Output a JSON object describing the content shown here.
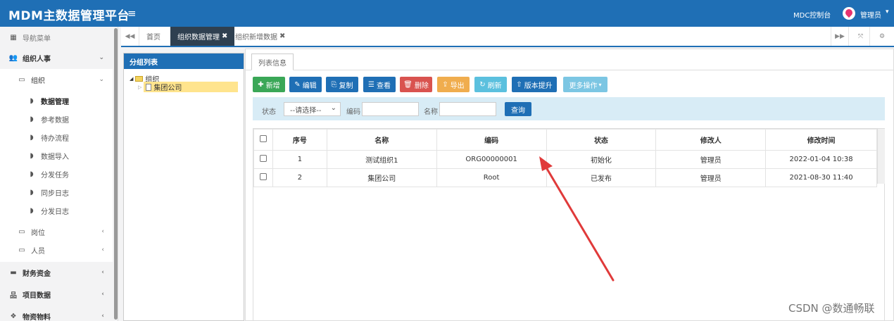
{
  "header": {
    "brand": "MDM主数据管理平台",
    "mdc_link": "MDC控制台",
    "user_name": "管理员"
  },
  "sidebar": {
    "nav_title": "导航菜单",
    "group_hr": "组织人事",
    "org": "组织",
    "org_items": [
      "数据管理",
      "参考数据",
      "待办流程",
      "数据导入",
      "分发任务",
      "同步日志",
      "分发日志"
    ],
    "position": "岗位",
    "person": "人员",
    "finance": "财务资金",
    "project": "项目数据",
    "material": "物资物料"
  },
  "tabs": {
    "home": "首页",
    "active": "组织数据管理",
    "second": "组织新增数据"
  },
  "tree": {
    "title": "分组列表",
    "root": "组织",
    "child": "集团公司"
  },
  "main": {
    "sub_tab": "列表信息",
    "buttons": {
      "add": "新增",
      "edit": "编辑",
      "copy": "复制",
      "view": "查看",
      "delete": "删除",
      "export": "导出",
      "refresh": "刷新",
      "upgrade": "版本提升",
      "more": "更多操作"
    },
    "filter": {
      "status_label": "状态",
      "status_value": "--请选择--",
      "code_label": "编码",
      "name_label": "名称",
      "query": "查询"
    },
    "table": {
      "headers": [
        "序号",
        "名称",
        "编码",
        "状态",
        "修改人",
        "修改时间"
      ],
      "rows": [
        [
          "1",
          "测试组织1",
          "ORG00000001",
          "初始化",
          "管理员",
          "2022-01-04 10:38"
        ],
        [
          "2",
          "集团公司",
          "Root",
          "已发布",
          "管理员",
          "2021-08-30 11:40"
        ]
      ]
    }
  },
  "watermark": "CSDN @数通畅联",
  "colors": {
    "primary": "#1f6fb5",
    "add": "#3aa757",
    "delete": "#d9534f",
    "export": "#f0ad4e",
    "refresh": "#5bc0de",
    "more": "#7cc6e3",
    "arrow": "#e03a3a"
  }
}
